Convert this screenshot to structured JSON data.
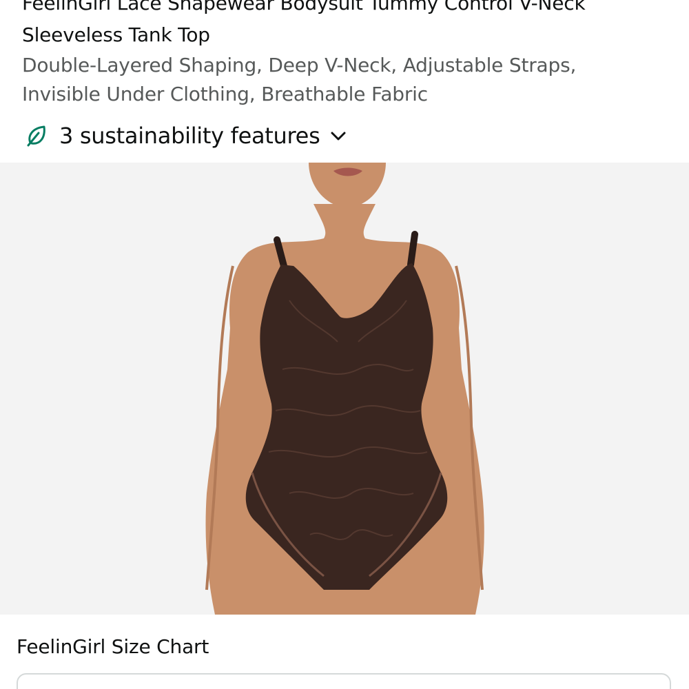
{
  "product": {
    "title_line1": "FeelinGirl Lace Shapewear Bodysuit Tummy Control V-Neck",
    "title_line2": "Sleeveless Tank Top",
    "subtitle_line1": "Double-Layered Shaping, Deep V-Neck, Adjustable Straps,",
    "subtitle_line2": "Invisible Under Clothing, Breathable Fabric"
  },
  "sustainability": {
    "label": "3 sustainability features",
    "icon": "leaf-icon",
    "chevron_icon": "chevron-down-icon",
    "accent_color": "#067d62"
  },
  "image": {
    "icon": "product-photo",
    "background_color": "#f3f3f3",
    "garment_color": "#3a2620",
    "skin_color": "#c9906a"
  },
  "size_chart": {
    "label": "FeelinGirl Size Chart"
  }
}
